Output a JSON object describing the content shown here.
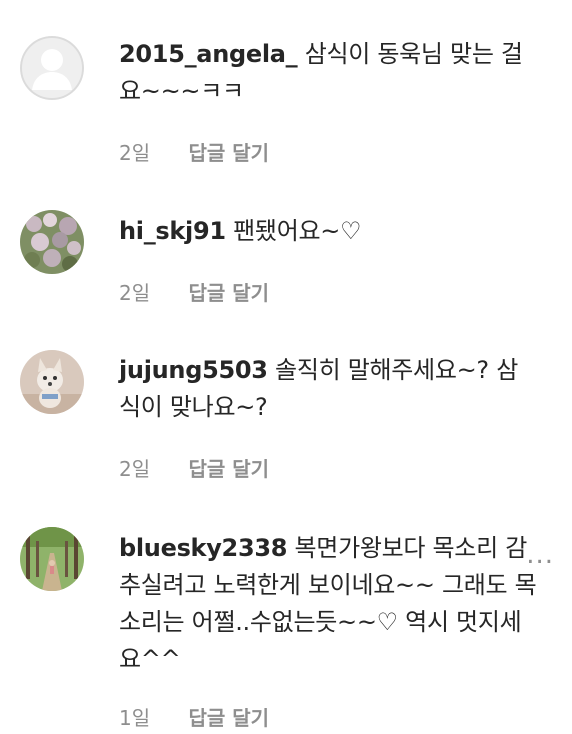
{
  "comments": [
    {
      "username": "2015_angela_",
      "text": "삼식이 동욱님 맞는 걸요~~~ㅋㅋ",
      "time": "2일",
      "reply": "답글 달기"
    },
    {
      "username": "hi_skj91",
      "text": "팬됐어요~♡",
      "time": "2일",
      "reply": "답글 달기"
    },
    {
      "username": "jujung5503",
      "text": "솔직히 말해주세요~? 삼식이 맞나요~?",
      "time": "2일",
      "reply": "답글 달기"
    },
    {
      "username": "bluesky2338",
      "text": "복면가왕보다 목소리 감추실려고 노력한게 보이네요~~ 그래도 목소리는 어쩔..수없는듯~~♡ 역시 멋지세요^^",
      "time": "1일",
      "reply": "답글 달기",
      "more": "..."
    }
  ],
  "avatars": [
    {
      "type": "default-avatar-icon",
      "color": "#dbdbdb"
    },
    {
      "type": "flowers-photo",
      "color": "#8a9a6e"
    },
    {
      "type": "dog-photo",
      "color": "#d8c7bb"
    },
    {
      "type": "trees-photo",
      "color": "#6b8f4a"
    }
  ]
}
